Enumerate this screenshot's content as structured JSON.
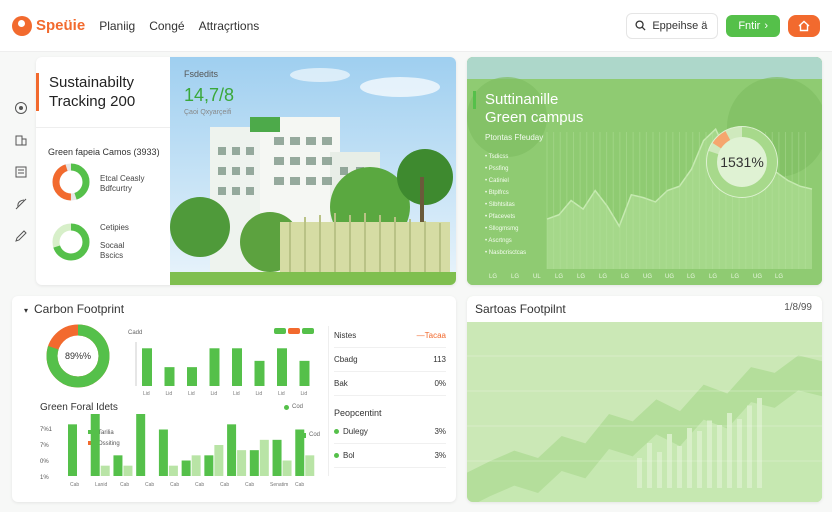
{
  "app": {
    "name": "Speüie"
  },
  "nav": [
    "Planiig",
    "Congé",
    "Attraçrtions"
  ],
  "header": {
    "search_label": "Eppeihse ä",
    "primary_btn": "Fntir",
    "secondary_btn": ""
  },
  "sidebar": {
    "icons": [
      "target-icon",
      "building-icon",
      "document-icon",
      "leaf-icon",
      "pen-icon"
    ]
  },
  "tracking": {
    "title_1": "Sustainabilty",
    "title_2": "Tracking 200",
    "num_label": "Fsdedits",
    "num_value": "14,7/8",
    "num_sub": "Çaoi Qxyarçeifi",
    "sub_title": "Green fapeia Camos (3933)",
    "donut1": {
      "l1": "Etcal Ceasly",
      "l2": "Bdfcurtry",
      "fill_pct": 45
    },
    "donut2": {
      "l1": "Cetipies",
      "l2": "Socaal",
      "l3": "Bscics",
      "fill_pct": 70
    }
  },
  "campus": {
    "title_1": "Suttinanille",
    "title_2": "Green campus",
    "subtitle": "Ptontas Ffeuday",
    "list": [
      "Tsdicss",
      "Pssfing",
      "Catiniel",
      "Btplfrcs",
      "Slbhtsitas",
      "Pfacevets",
      "Sllogmsmg",
      "Ascrtngs",
      "Nasbcrisctcas"
    ],
    "donut_value": "1531%",
    "donut_pct": 80,
    "chart_data": {
      "type": "area",
      "values": [
        35,
        38,
        48,
        42,
        55,
        44,
        30,
        52,
        50,
        47,
        55,
        58,
        70,
        90,
        98,
        80,
        60,
        58,
        66,
        68,
        62,
        58,
        56
      ],
      "ylim": [
        0,
        110
      ]
    },
    "x_ticks": [
      "LG",
      "LG",
      "UL",
      "LG",
      "LG",
      "LG",
      "LG",
      "UG",
      "UG",
      "LG",
      "LG",
      "LG",
      "UG",
      "LG"
    ]
  },
  "carbon": {
    "title": "Carbon Footprint",
    "donut_value": "89%%",
    "donut_pct": 80,
    "colors": {
      "green": "#55c04a",
      "light": "#b9e4a6",
      "orange": "#f26a2e"
    },
    "top_chart": {
      "chart_data": {
        "type": "bar",
        "categories": [
          "Lid",
          "Lid",
          "Lid",
          "Lid",
          "Lid",
          "Lid",
          "Lid",
          "Lid"
        ],
        "values": [
          6,
          3,
          3,
          6,
          6,
          4,
          6,
          4
        ],
        "values_light": [
          6,
          3,
          3,
          6,
          6,
          4,
          6,
          4
        ],
        "ylim": [
          0,
          7
        ]
      },
      "legend": [
        "",
        ""
      ],
      "ylabel_top": "Cadd"
    },
    "bottom_title": "Green Foral Idets",
    "bottom_chart": {
      "chart_data": {
        "type": "bar",
        "series": [
          {
            "name": "Tarilia",
            "values": [
              10,
              12,
              4,
              12,
              9,
              3,
              4,
              10,
              5,
              7,
              9
            ]
          },
          {
            "name": "Ossiting",
            "values": [
              0,
              2,
              2,
              0,
              2,
              4,
              6,
              5,
              7,
              3,
              4
            ]
          }
        ],
        "categories": [
          "Cab",
          "Lanid",
          "Cab",
          "Cab",
          "Cab",
          "Cab",
          "Cab",
          "Cab",
          "Senatim",
          "Cab"
        ],
        "ylim": [
          0,
          12
        ]
      },
      "legend": [
        "Tarilia",
        "Ossiting"
      ],
      "y_ticks": [
        "7%1",
        "7%",
        "0%",
        "1%"
      ],
      "right_legend": [
        "Cod",
        "Cod"
      ]
    },
    "table": {
      "header": [
        "Nistes",
        "—Tacaa"
      ],
      "rows": [
        [
          "Cbadg",
          "113"
        ],
        [
          "Bak",
          "0%"
        ]
      ],
      "section": "Peopcentint",
      "rows2": [
        [
          "Dulegy",
          "3%"
        ],
        [
          "Bol",
          "3%"
        ]
      ]
    }
  },
  "footprint": {
    "title": "Sartoas Footpilnt",
    "value": "1/8/99",
    "chart_data": {
      "type": "area",
      "values": [
        20,
        28,
        35,
        30,
        45,
        40,
        60,
        55,
        70,
        62,
        80,
        74,
        92,
        88,
        100,
        96
      ],
      "bars": [
        20,
        30,
        24,
        36,
        28,
        40,
        38,
        45,
        42,
        50,
        46,
        55,
        60
      ],
      "ylim": [
        0,
        120
      ]
    }
  }
}
